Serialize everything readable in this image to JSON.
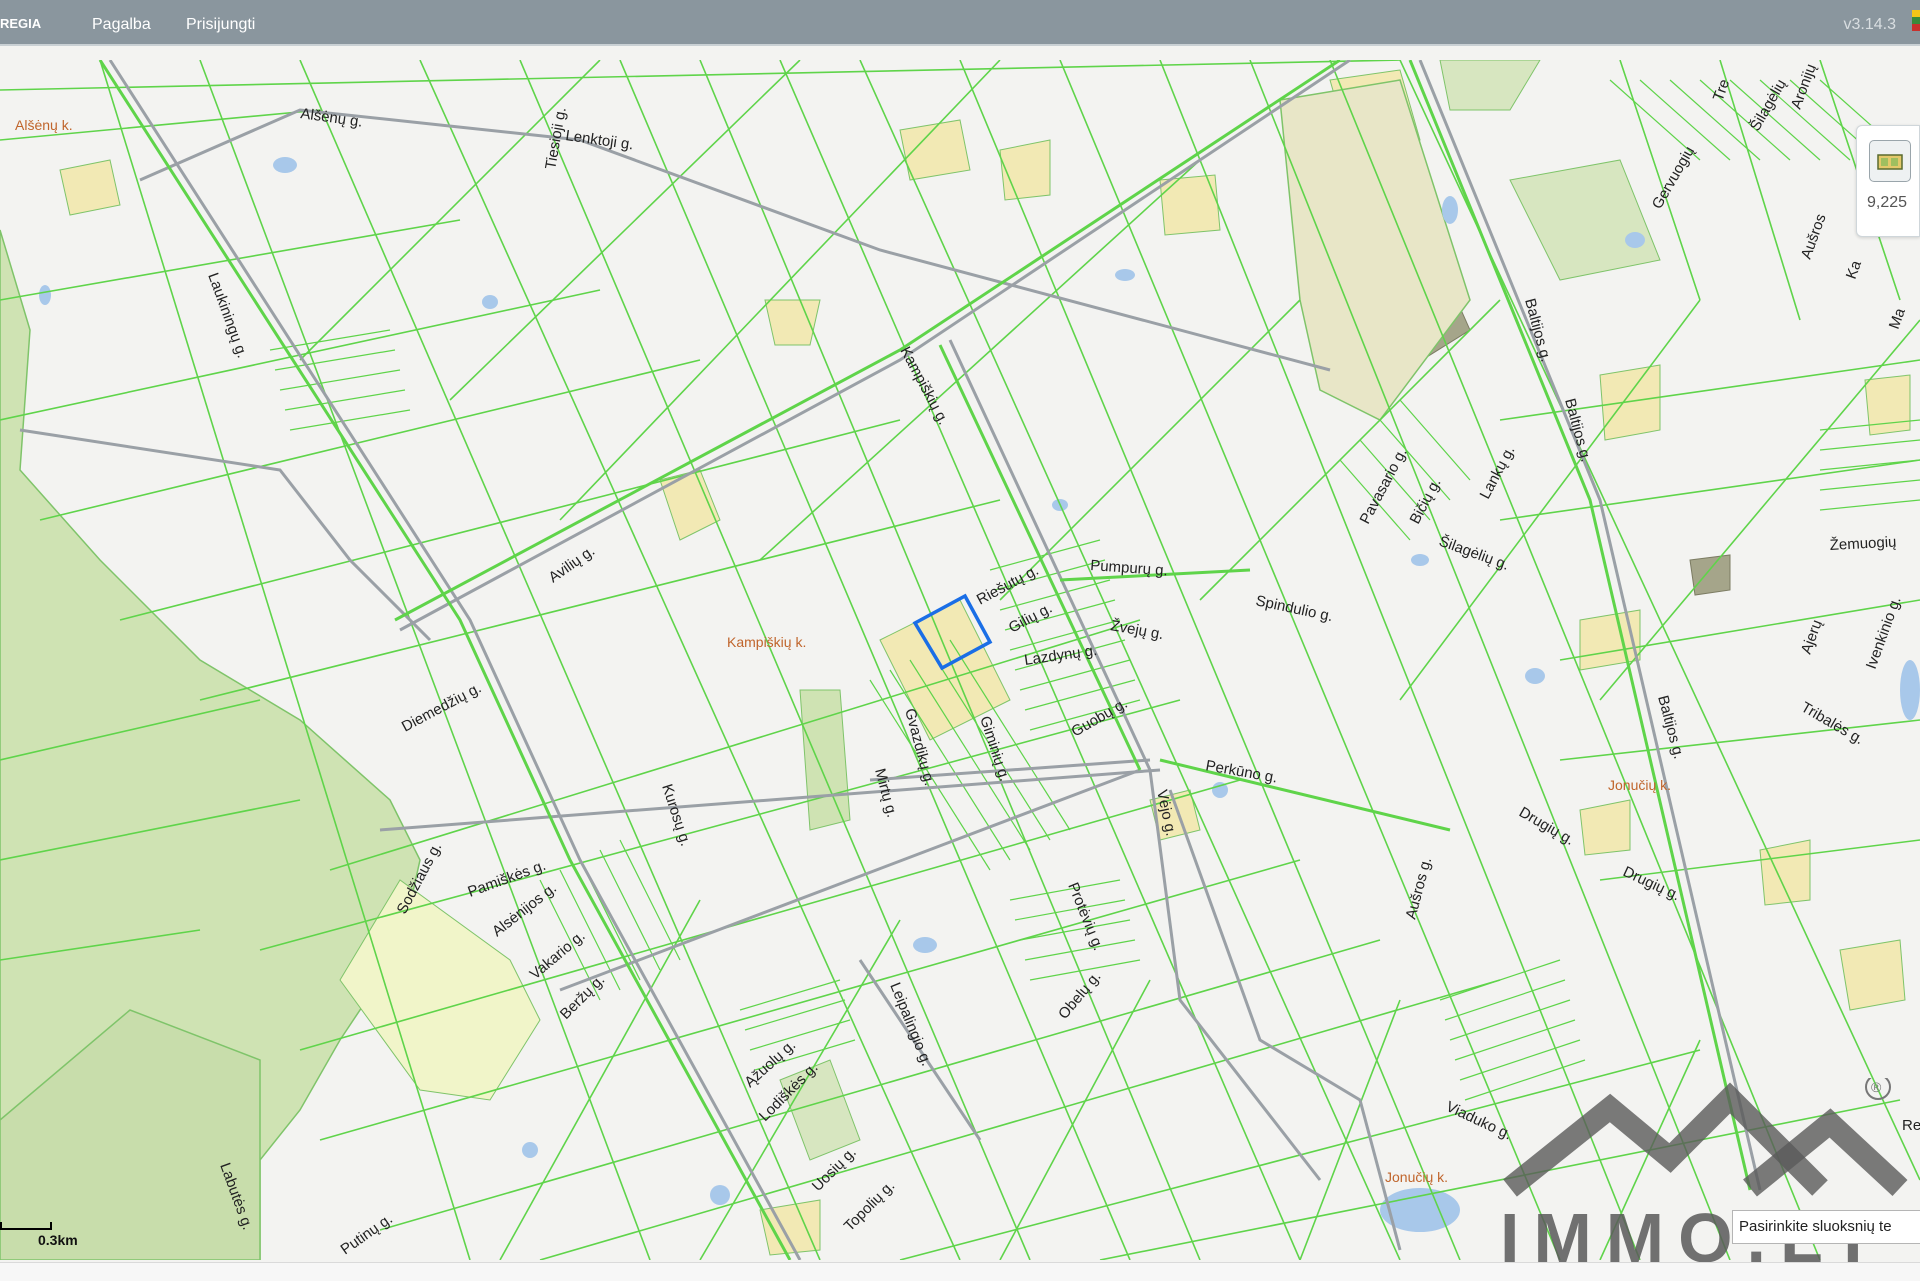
{
  "header": {
    "brand": "REGIA",
    "menu": [
      "Pagalba",
      "Prisijungti"
    ],
    "version": "v3.14.3"
  },
  "layer_control": {
    "value": "9,225"
  },
  "scale_bar": {
    "label": "0.3km"
  },
  "layer_hint": "Pasirinkite sluoksnių te",
  "watermark": {
    "text": "IMMO.LT",
    "registered": "®"
  },
  "map": {
    "villages": [
      "Alšėnų k.",
      "Kampiškių k.",
      "Jonučių k.",
      "Jonučių k."
    ],
    "streets": [
      "Alšėnų g.",
      "Tiesioji g.",
      "Lenktoji g.",
      "Laukiningų g.",
      "Avilių g.",
      "Kampiškių g.",
      "Pumpurų g.",
      "Riešutų g.",
      "Gilių g.",
      "Lazdynų g.",
      "Žvejų g.",
      "Spindulio g.",
      "Diemedžių g.",
      "Gvazdikų g.",
      "Mirtų g.",
      "Giminių g.",
      "Guobų g.",
      "Kurosų g.",
      "Perkūno g.",
      "Vėjo g.",
      "Sodžiaus g.",
      "Pamiškės g.",
      "Alsėnijos g.",
      "Vakario g.",
      "Beržų g.",
      "Protėvių g.",
      "Obelų g.",
      "Leipalingio g.",
      "Ąžuolų g.",
      "Lodiškės g.",
      "Uosių g.",
      "Topolių g.",
      "Putinų g.",
      "Labutės g.",
      "Pavasario g.",
      "Bičių g.",
      "Lankų g.",
      "Šilagėlių g.",
      "Baltijos g.",
      "Baltijos g.",
      "Baltijos g.",
      "Aušros g.",
      "Drugių g.",
      "Drugių g.",
      "Viaduko g.",
      "Tribalės g.",
      "Žemuogių",
      "Ajerų",
      "Ivenkinio g.",
      "Gervuogių",
      "Aušros",
      "Šilagėlių",
      "Aronijų",
      "Tre",
      "Ka",
      "Ma",
      "Re"
    ],
    "selected_parcel": "selected-parcel"
  },
  "colors": {
    "parcel_line": "#5fd44a",
    "road_line": "#9aa0a6",
    "forest": "#cfe3b3",
    "building_yellow": "#f2e9b4",
    "selected": "#1a6ee6",
    "water": "#a8c8ea",
    "header_bg": "#8a969e"
  }
}
